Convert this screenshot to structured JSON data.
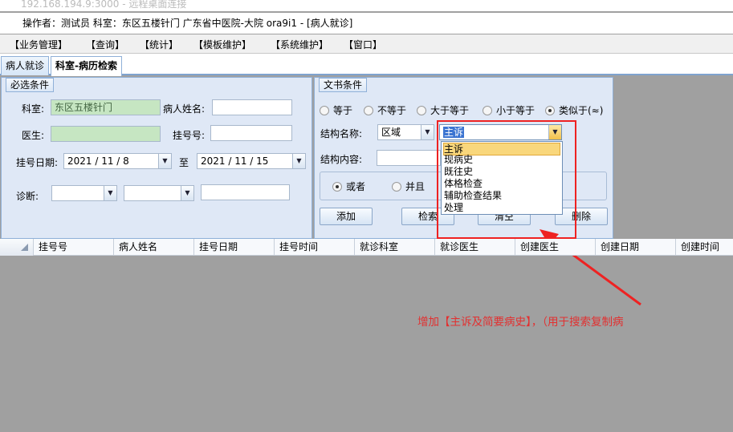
{
  "remote_window": {
    "title": "192.168.194.9:3000 - 远程桌面连接"
  },
  "app": {
    "title": "操作者：测试员  科室：东区五楼针门  广东省中医院-大院 ora9i1 - [病人就诊]"
  },
  "menu": [
    "【业务管理】",
    "【查询】",
    "【统计】",
    "【模板维护】",
    "【系统维护】",
    "【窗口】"
  ],
  "tabs": [
    {
      "label": "病人就诊",
      "active": false
    },
    {
      "label": "科室-病历检索",
      "active": true
    }
  ],
  "required": {
    "title": "必选条件",
    "dept_label": "科室:",
    "dept_value": "东区五楼针门",
    "patient_label": "病人姓名:",
    "patient_value": "",
    "doctor_label": "医生:",
    "doctor_value": "",
    "regno_label": "挂号号:",
    "regno_value": "",
    "date_label": "挂号日期:",
    "date_from": "2021 / 11 / 8",
    "to_label": "至",
    "date_to": "2021 / 11 / 15",
    "diag_label": "诊断:",
    "diag_value1": "",
    "diag_value2": "",
    "diag_value3": ""
  },
  "doc": {
    "title": "文书条件",
    "ops": [
      {
        "label": "等于",
        "checked": false
      },
      {
        "label": "不等于",
        "checked": false
      },
      {
        "label": "大于等于",
        "checked": false
      },
      {
        "label": "小于等于",
        "checked": false
      },
      {
        "label": "类似于(≈)",
        "checked": true
      }
    ],
    "struct_label": "结构名称:",
    "struct_region": "区域",
    "struct_field": "主诉",
    "content_label": "结构内容:",
    "content_value": "",
    "logic": [
      {
        "label": "或者",
        "checked": true
      },
      {
        "label": "并且",
        "checked": false
      }
    ],
    "buttons": {
      "add": "添加",
      "search": "检索",
      "clear": "清空",
      "delete": "删除"
    },
    "field_options": [
      "主诉",
      "现病史",
      "既往史",
      "体格检查",
      "辅助检查结果",
      "处理"
    ],
    "selected_option": "主诉"
  },
  "grid": {
    "columns": [
      "挂号号",
      "病人姓名",
      "挂号日期",
      "挂号时间",
      "就诊科室",
      "就诊医生",
      "创建医生",
      "创建日期",
      "创建时间"
    ]
  },
  "annotation": {
    "text": "增加【主诉及简要病史】，（用于搜索复制病",
    "color": "#e23030"
  }
}
